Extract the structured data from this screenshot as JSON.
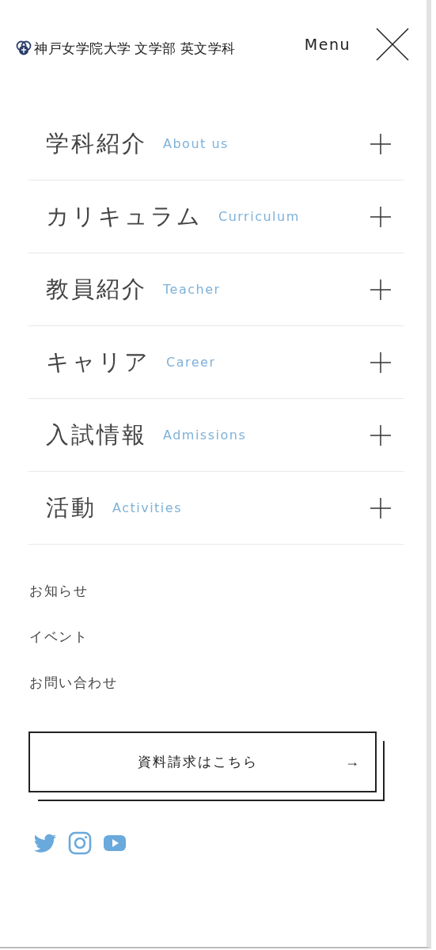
{
  "header": {
    "site_title": "神戸女学院大学 文学部 英文学科",
    "menu_label": "Menu"
  },
  "nav": [
    {
      "title": "学科紹介",
      "subtitle": "About us",
      "expanded": false
    },
    {
      "title": "カリキュラム",
      "subtitle": "Curriculum",
      "expanded": false
    },
    {
      "title": "教員紹介",
      "subtitle": "Teacher",
      "expanded": false
    },
    {
      "title": "キャリア",
      "subtitle": "Career",
      "expanded": false
    },
    {
      "title": "入試情報",
      "subtitle": "Admissions",
      "expanded": false
    },
    {
      "title": "活動",
      "subtitle": "Activities",
      "expanded": false
    }
  ],
  "links": [
    "お知らせ",
    "イベント",
    "お問い合わせ"
  ],
  "cta": {
    "label": "資料請求はこちら",
    "arrow": "→"
  },
  "social": [
    {
      "kind": "twitter"
    },
    {
      "kind": "instagram"
    },
    {
      "kind": "youtube"
    }
  ]
}
